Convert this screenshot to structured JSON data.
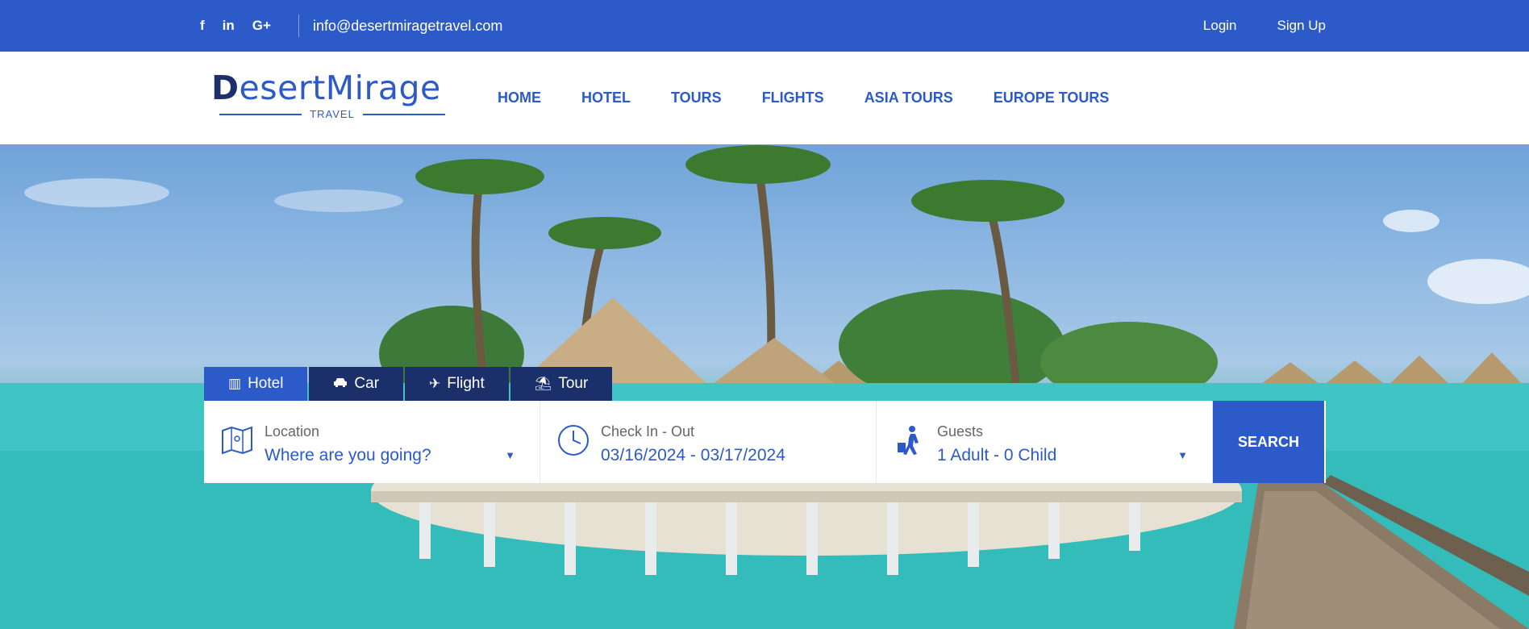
{
  "topbar": {
    "social": [
      {
        "icon": "facebook-icon",
        "glyph": "f"
      },
      {
        "icon": "linkedin-icon",
        "glyph": "in"
      },
      {
        "icon": "google-plus-icon",
        "glyph": "G+"
      }
    ],
    "email": "info@desertmiragetravel.com",
    "login": "Login",
    "signup": "Sign Up"
  },
  "logo": {
    "brand_initial": "D",
    "brand_rest": "esertMirage",
    "tagline": "TRAVEL"
  },
  "nav": [
    "HOME",
    "HOTEL",
    "TOURS",
    "FLIGHTS",
    "ASIA TOURS",
    "EUROPE TOURS"
  ],
  "search": {
    "tabs": [
      {
        "label": "Hotel",
        "icon": "building-icon",
        "glyph": "▥",
        "active": true
      },
      {
        "label": "Car",
        "icon": "car-icon",
        "glyph": "🚗",
        "active": false
      },
      {
        "label": "Flight",
        "icon": "plane-icon",
        "glyph": "✈",
        "active": false
      },
      {
        "label": "Tour",
        "icon": "beach-icon",
        "glyph": "⛱",
        "active": false
      }
    ],
    "location": {
      "label": "Location",
      "value": "Where are you going?"
    },
    "dates": {
      "label": "Check In - Out",
      "value": "03/16/2024 - 03/17/2024"
    },
    "guests": {
      "label": "Guests",
      "value": "1 Adult - 0 Child"
    },
    "button": "SEARCH"
  },
  "colors": {
    "primary": "#2c5ac8",
    "dark_tab": "#1b2f6b",
    "water": "#3fc2c2"
  }
}
